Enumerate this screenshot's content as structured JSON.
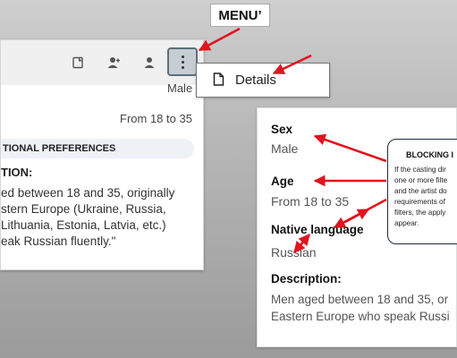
{
  "left_card": {
    "male_tag": "Male",
    "age_range": "From 18 to 35",
    "preferences_header": "TIONAL PREFERENCES",
    "description_header": "TION:",
    "description_lines": [
      "ed between 18 and 35, originally",
      "stern Europe (Ukraine, Russia,",
      "Lithuania, Estonia, Latvia, etc.)",
      "eak Russian fluently.\""
    ]
  },
  "toolbar": {
    "icons": [
      "document-icon",
      "person-add-icon",
      "person-icon",
      "more-vertical-icon"
    ]
  },
  "annotations": {
    "menu_label": "MENU’",
    "blocking_title": "BLOCKING I",
    "blocking_lines": [
      "If the casting dir",
      "one or more filte",
      "and the artist do",
      "requirements of",
      "filters, the apply",
      "appear."
    ],
    "arrow_color": "#e0141e"
  },
  "popup": {
    "details_label": "Details"
  },
  "right_card": {
    "sex_label": "Sex",
    "sex_value": "Male",
    "age_label": "Age",
    "age_value": "From 18 to 35",
    "language_label": "Native language",
    "language_value": "Russian",
    "description_label": "Description:",
    "description_lines": [
      "Men aged between 18 and 35, or",
      "Eastern Europe who speak Russi"
    ]
  }
}
